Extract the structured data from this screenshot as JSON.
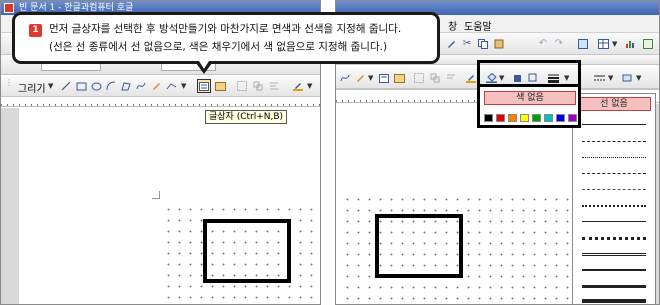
{
  "left_window": {
    "title": "빈 문서 1 - 한글과컴퓨터 호글",
    "toolbar": {
      "draw_label": "그리기"
    },
    "tooltip": "글상자 (Ctrl+N,B)"
  },
  "right_window": {
    "menu": {
      "item_1": "창(W)",
      "item_1_visible": "창",
      "item_2": "도움말(H)",
      "item_2_visible": "도움말"
    },
    "color_dropdown": {
      "no_color_label": "색 없음",
      "swatch_colors": [
        "#000000",
        "#e00000",
        "#ff8000",
        "#ffff00",
        "#00a000",
        "#00c0c0",
        "#0000e0",
        "#a000c0"
      ]
    },
    "line_panel": {
      "no_line_label": "선 없음"
    }
  },
  "callout": {
    "step": "1",
    "line_1": "먼저 글상자를 선택한 후 방석만들기와 마찬가지로 면색과 선색을 지정해 줍니다.",
    "line_2": "(선은 선 종류에서 선 없음으로, 색은 채우기에서 색 없음으로 지정해 줍니다.)"
  },
  "colors": {
    "accent_red": "#e03a2c",
    "highlight_pink": "#f6c0c0",
    "tooltip_bg": "#ffffe1"
  }
}
